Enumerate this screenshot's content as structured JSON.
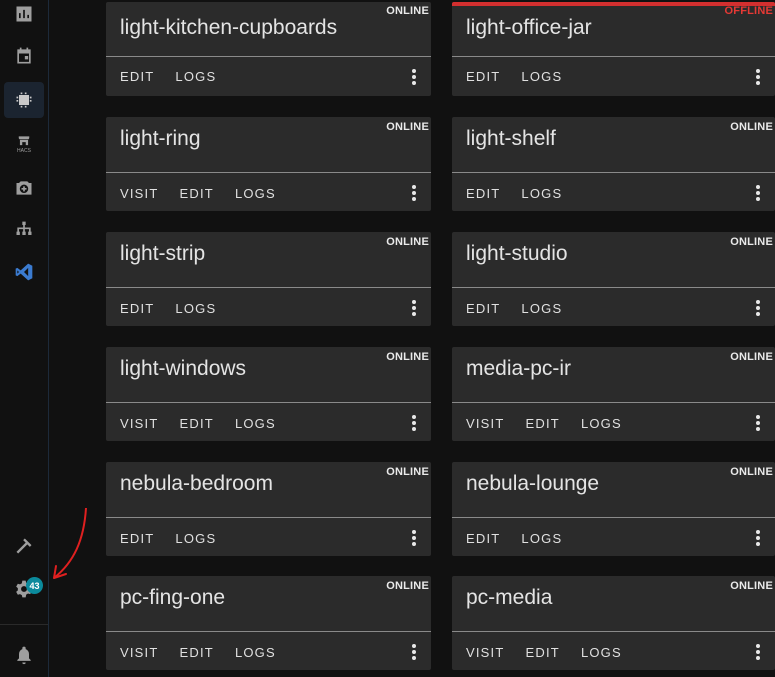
{
  "sidebar": {
    "icons": [
      "dashboard-icon",
      "calendar-icon",
      "esphome-chip-icon",
      "hacs-store-icon",
      "camera-add-icon",
      "network-icon",
      "vscode-icon",
      "hammer-icon",
      "gear-icon",
      "bell-icon"
    ],
    "hacs_label": "HACS",
    "settings_badge": "43"
  },
  "devices": [
    {
      "name": "light-kitchen-cupboards",
      "status": "ONLINE",
      "actions": [
        "EDIT",
        "LOGS"
      ]
    },
    {
      "name": "light-office-jar",
      "status": "OFFLINE",
      "actions": [
        "EDIT",
        "LOGS"
      ]
    },
    {
      "name": "light-ring",
      "status": "ONLINE",
      "actions": [
        "VISIT",
        "EDIT",
        "LOGS"
      ]
    },
    {
      "name": "light-shelf",
      "status": "ONLINE",
      "actions": [
        "EDIT",
        "LOGS"
      ]
    },
    {
      "name": "light-strip",
      "status": "ONLINE",
      "actions": [
        "EDIT",
        "LOGS"
      ]
    },
    {
      "name": "light-studio",
      "status": "ONLINE",
      "actions": [
        "EDIT",
        "LOGS"
      ]
    },
    {
      "name": "light-windows",
      "status": "ONLINE",
      "actions": [
        "VISIT",
        "EDIT",
        "LOGS"
      ]
    },
    {
      "name": "media-pc-ir",
      "status": "ONLINE",
      "actions": [
        "VISIT",
        "EDIT",
        "LOGS"
      ]
    },
    {
      "name": "nebula-bedroom",
      "status": "ONLINE",
      "actions": [
        "EDIT",
        "LOGS"
      ]
    },
    {
      "name": "nebula-lounge",
      "status": "ONLINE",
      "actions": [
        "EDIT",
        "LOGS"
      ]
    },
    {
      "name": "pc-fing-one",
      "status": "ONLINE",
      "actions": [
        "VISIT",
        "EDIT",
        "LOGS"
      ]
    },
    {
      "name": "pc-media",
      "status": "ONLINE",
      "actions": [
        "VISIT",
        "EDIT",
        "LOGS"
      ]
    }
  ],
  "colors": {
    "offline": "#e53935",
    "accent_badge": "#0b8a9c",
    "annotation_arrow": "#e02020"
  }
}
